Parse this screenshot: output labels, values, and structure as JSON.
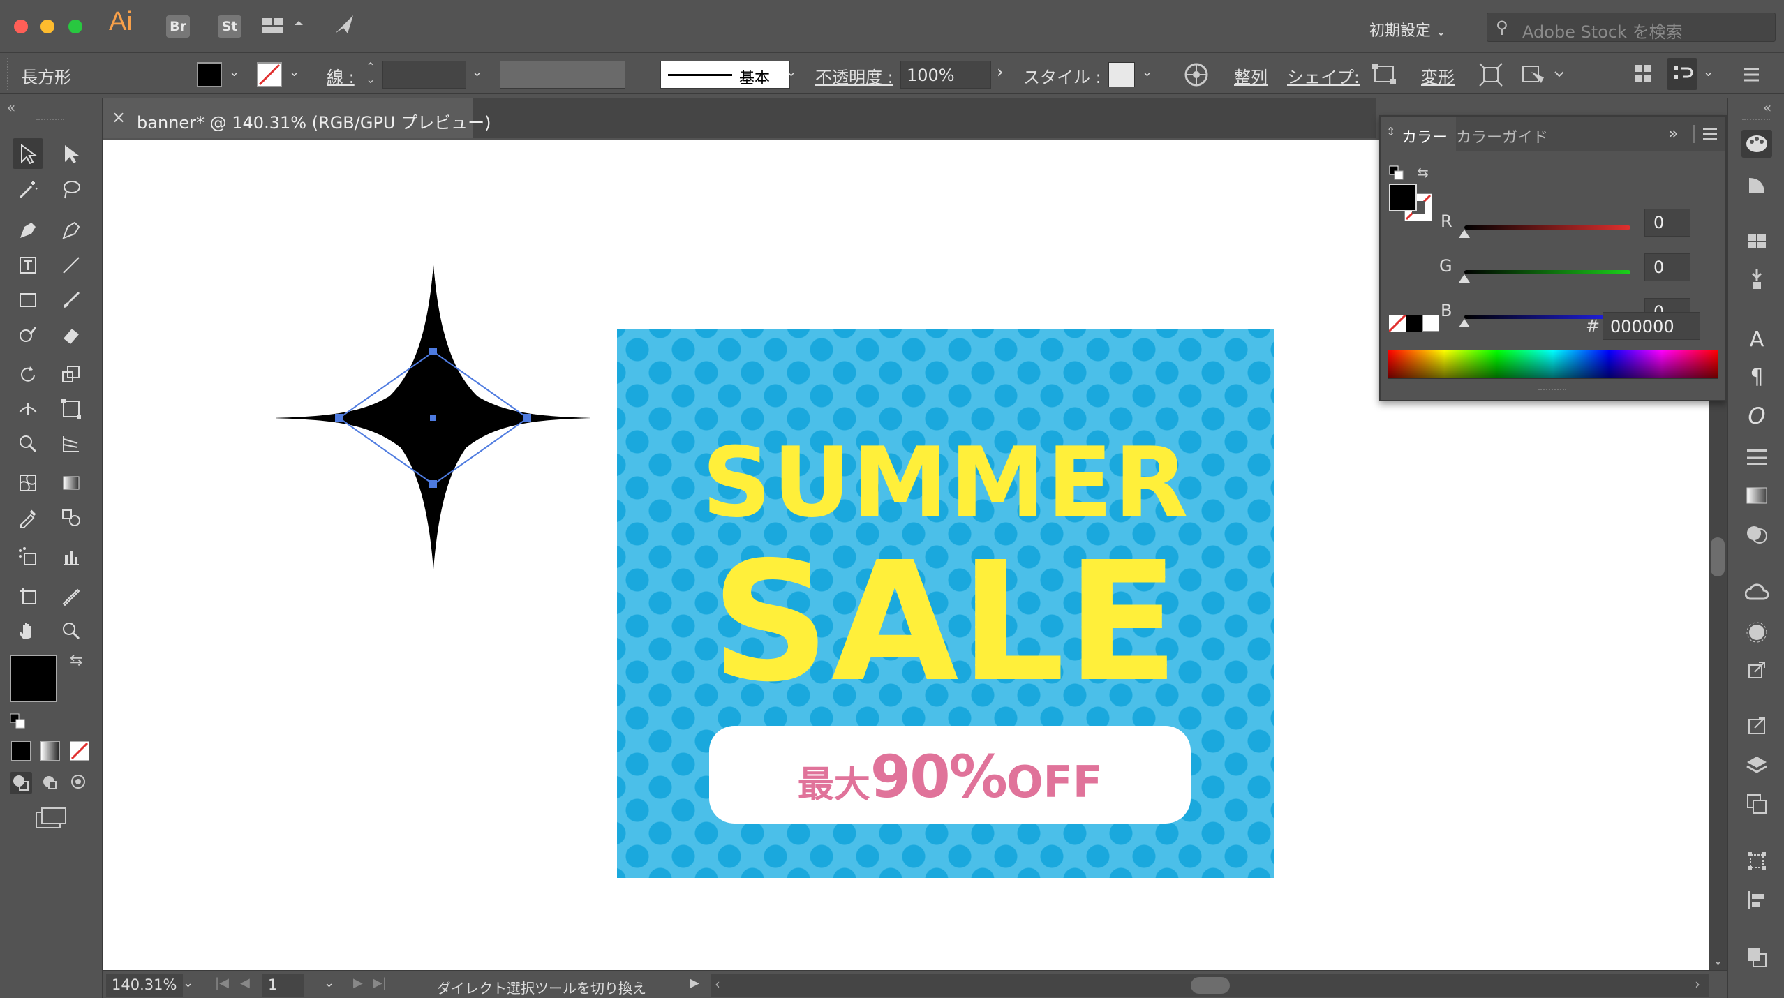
{
  "app": {
    "logo": "Ai",
    "bridge": "Br",
    "stock": "St",
    "workspace": "初期設定",
    "search_placeholder": "Adobe Stock を検索"
  },
  "control": {
    "object_type": "長方形",
    "stroke_label": "線 :",
    "brush_label": "基本",
    "opacity_label": "不透明度 :",
    "opacity_value": "100%",
    "style_label": "スタイル :",
    "align_label": "整列",
    "shape_label": "シェイプ:",
    "transform_label": "変形"
  },
  "document": {
    "tab_title": "banner* @ 140.31% (RGB/GPU プレビュー)",
    "close": "×"
  },
  "color_panel": {
    "tab_color": "カラー",
    "tab_guide": "カラーガイド",
    "r_label": "R",
    "r_value": "0",
    "g_label": "G",
    "g_value": "0",
    "b_label": "B",
    "b_value": "0",
    "hex_label": "#",
    "hex_value": "000000"
  },
  "banner": {
    "line1": "SUMMER",
    "line2": "SALE",
    "prefix": "最大",
    "percent": "90%",
    "off": "OFF",
    "bg_color": "#4bbfe9",
    "text_color": "#ffef3a",
    "accent_color": "#e0739a"
  },
  "status": {
    "zoom": "140.31%",
    "artboard": "1",
    "message": "ダイレクト選択ツールを切り換え"
  }
}
